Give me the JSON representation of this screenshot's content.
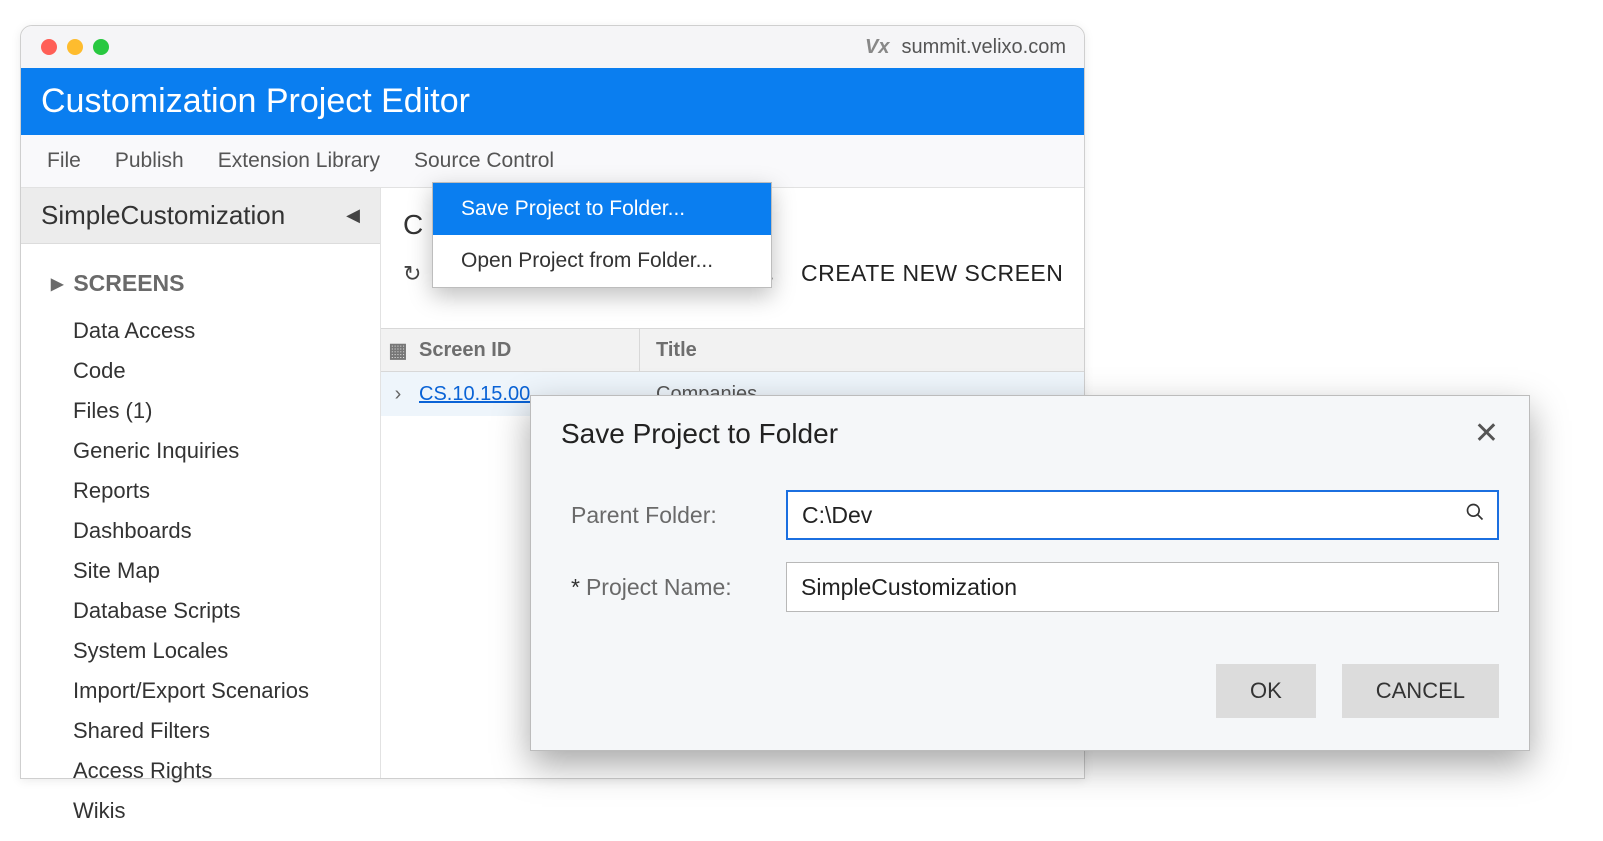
{
  "browser": {
    "brand": "Vx",
    "domain": "summit.velixo.com"
  },
  "header": {
    "title": "Customization Project Editor"
  },
  "menu": {
    "items": [
      "File",
      "Publish",
      "Extension Library",
      "Source Control"
    ]
  },
  "sidebar": {
    "project_name": "SimpleCustomization",
    "tree_header": "SCREENS",
    "items": [
      "Data Access",
      "Code",
      "Files (1)",
      "Generic Inquiries",
      "Reports",
      "Dashboards",
      "Site Map",
      "Database Scripts",
      "System Locales",
      "Import/Export Scenarios",
      "Shared Filters",
      "Access Rights",
      "Wikis"
    ]
  },
  "dropdown": {
    "items": [
      {
        "label": "Save Project to Folder...",
        "selected": true
      },
      {
        "label": "Open Project from Folder...",
        "selected": false
      }
    ]
  },
  "main": {
    "visible_letter": "C",
    "create_label": "CREATE NEW SCREEN",
    "table": {
      "headers": {
        "screen_id": "Screen ID",
        "title": "Title"
      },
      "rows": [
        {
          "screen_id": "CS.10.15.00",
          "title": "Companies"
        }
      ]
    }
  },
  "dialog": {
    "title": "Save Project to Folder",
    "fields": {
      "parent_folder": {
        "label": "Parent Folder:",
        "value": "C:\\Dev"
      },
      "project_name": {
        "label": "Project Name:",
        "value": "SimpleCustomization",
        "required_mark": "*"
      }
    },
    "buttons": {
      "ok": "OK",
      "cancel": "CANCEL"
    }
  }
}
